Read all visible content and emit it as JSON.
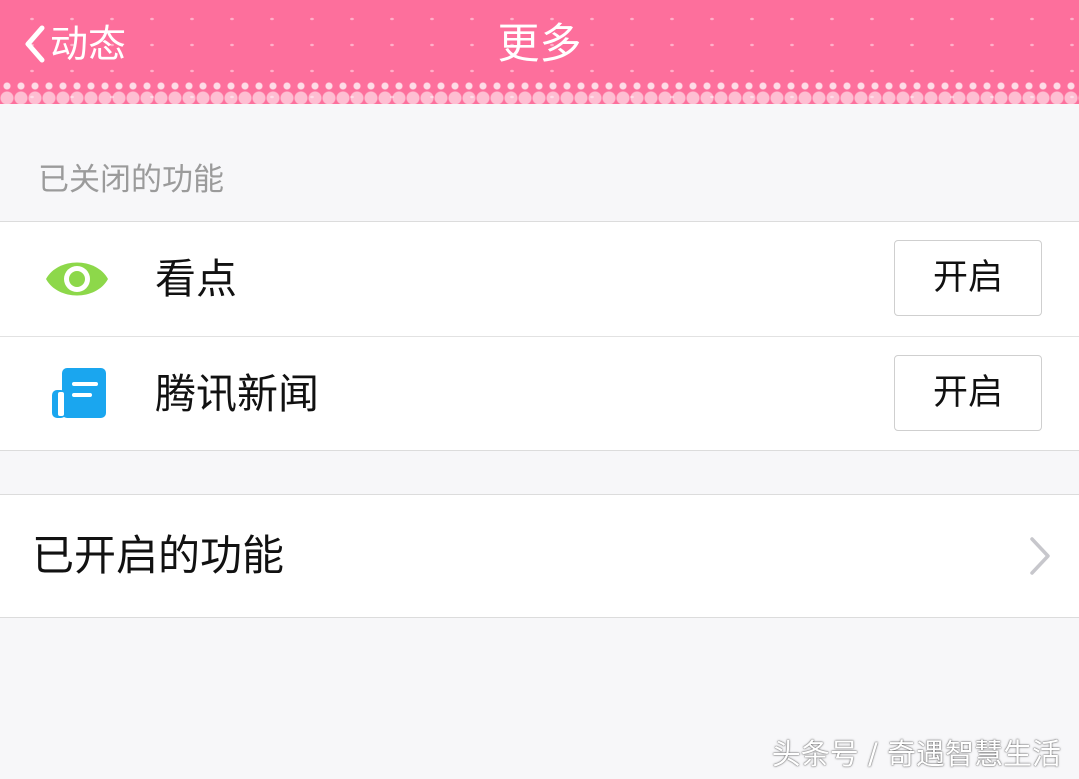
{
  "nav": {
    "back_label": "动态",
    "title": "更多",
    "back_icon": "chevron-left-icon",
    "background_color": "#fd6f9c"
  },
  "closed_section": {
    "header": "已关闭的功能",
    "items": [
      {
        "label": "看点",
        "icon": "eye-icon",
        "icon_color": "#8dd84a",
        "button_label": "开启"
      },
      {
        "label": "腾讯新闻",
        "icon": "news-icon",
        "icon_color": "#1aa6ef",
        "button_label": "开启"
      }
    ]
  },
  "opened_section": {
    "label": "已开启的功能",
    "icon": "chevron-right-icon"
  },
  "watermark": "头条号 / 奇遇智慧生活"
}
